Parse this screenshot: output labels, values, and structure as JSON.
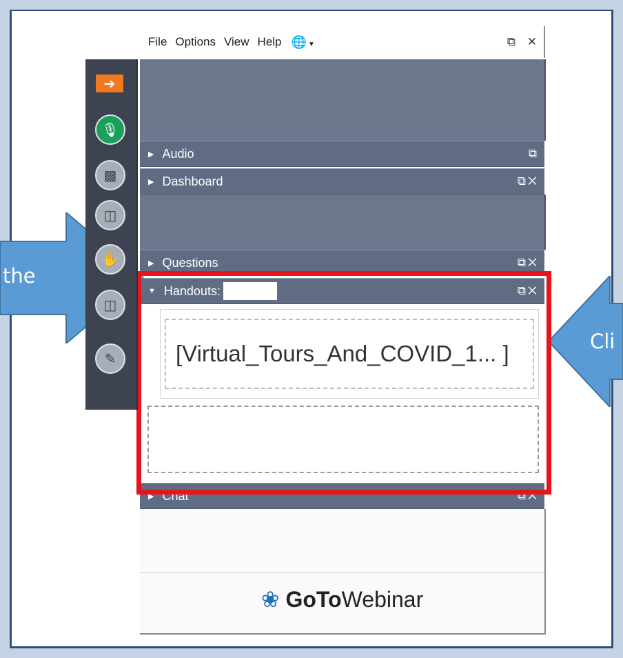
{
  "menu": {
    "items": [
      "File",
      "Options",
      "View",
      "Help"
    ],
    "globe_icon": "globe-icon"
  },
  "sections": {
    "audio": "Audio",
    "dashboard": "Dashboard",
    "questions": "Questions",
    "handouts": "Handouts:",
    "chat": "Chat"
  },
  "handout": {
    "file_label": "[Virtual_Tours_And_COVID_1... ]"
  },
  "brand": {
    "goto": "GoTo",
    "webinar": "Webinar"
  },
  "callouts": {
    "left_text_line1": "the",
    "left_text_line2": "",
    "right_text": "Cli"
  },
  "colors": {
    "highlight": "#e8141c",
    "arrow_fill": "#5b9bd5",
    "panel_bg": "#6a778d",
    "mic_active": "#1aa05a",
    "show_panel": "#ef7a20"
  }
}
